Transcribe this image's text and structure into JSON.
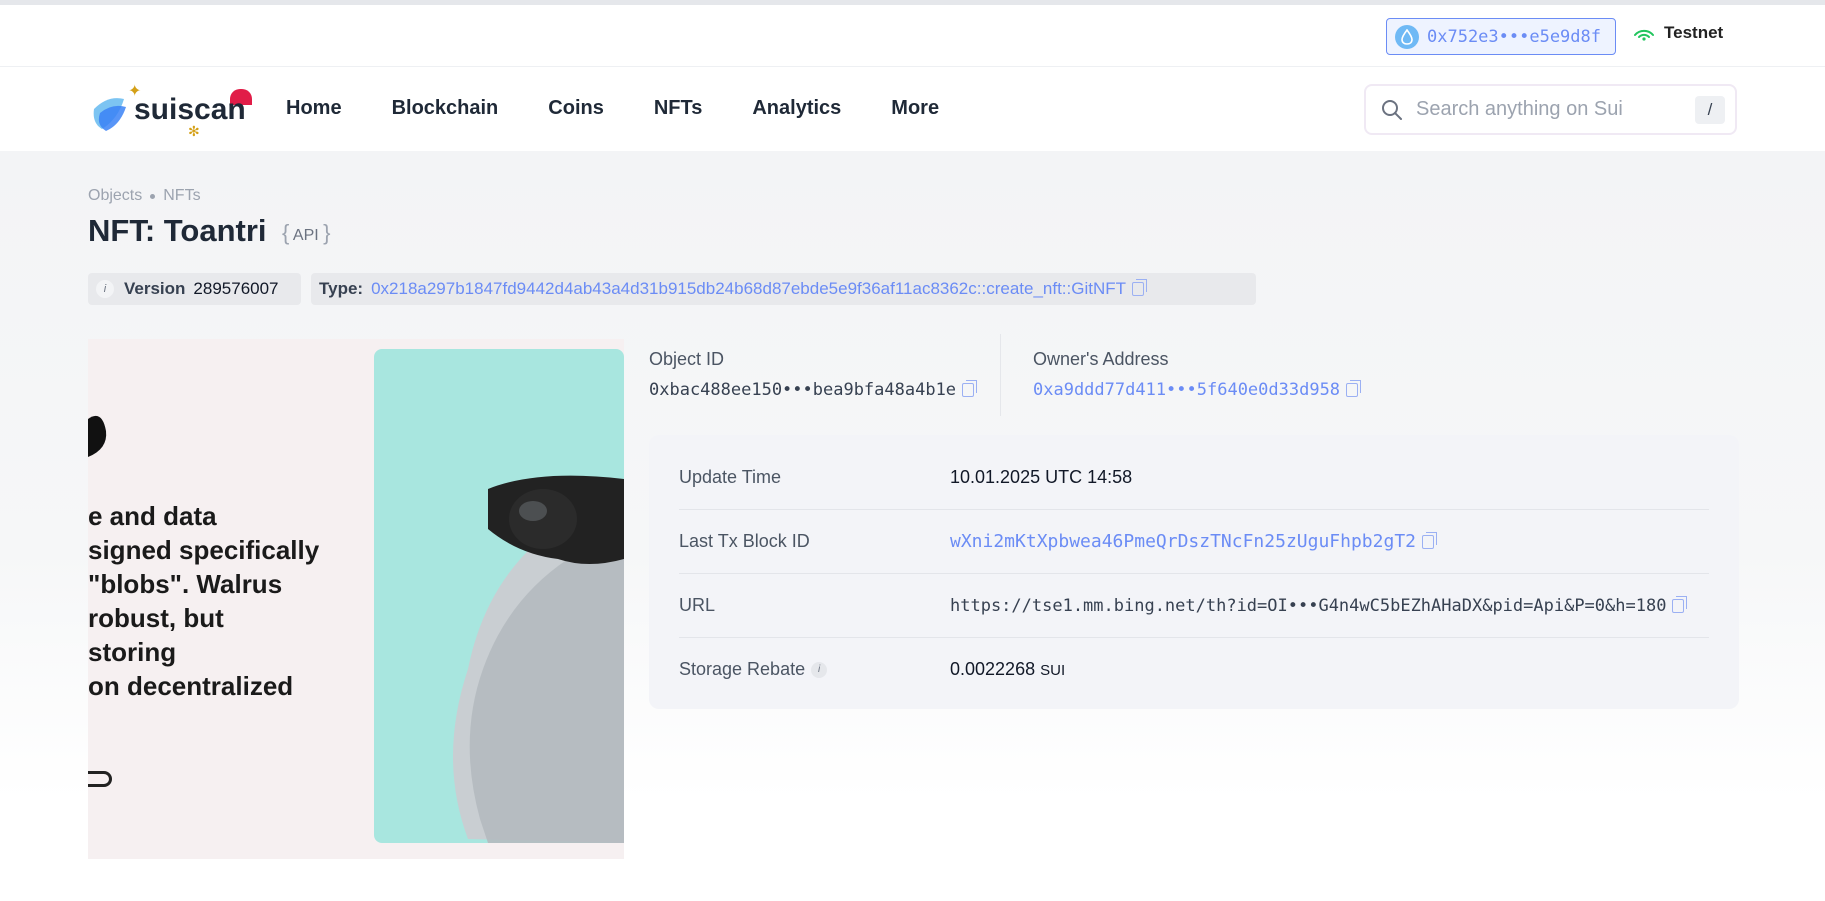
{
  "header": {
    "wallet_address": "0x752e3•••e5e9d8f",
    "network": "Testnet"
  },
  "navbar": {
    "logo_text": "suiscan",
    "items": [
      "Home",
      "Blockchain",
      "Coins",
      "NFTs",
      "Analytics",
      "More"
    ],
    "search_placeholder": "Search anything on Sui",
    "search_shortcut": "/"
  },
  "breadcrumb": [
    "Objects",
    "NFTs"
  ],
  "page": {
    "title": "NFT: Toantri",
    "api_label": "API"
  },
  "meta": {
    "version_label": "Version",
    "version_value": "289576007",
    "type_label": "Type:",
    "type_value": "0x218a297b1847fd9442d4ab43a4d31b915db24b68d87ebde5e9f36af11ac8362c::create_nft::GitNFT"
  },
  "nft_image": {
    "text_lines": [
      "e and data",
      "signed specifically",
      "\"blobs\". Walrus",
      "robust, but",
      "storing",
      "on decentralized"
    ]
  },
  "object": {
    "object_id_label": "Object ID",
    "object_id_value": "0xbac488ee150•••bea9bfa48a4b1e",
    "owner_label": "Owner's Address",
    "owner_value": "0xa9ddd77d411•••5f640e0d33d958"
  },
  "details": [
    {
      "label": "Update Time",
      "value": "10.01.2025 UTC 14:58"
    },
    {
      "label": "Last Tx Block ID",
      "value": "wXni2mKtXpbwea46PmeQrDszTNcFn25zUguFhpb2gT2"
    },
    {
      "label": "URL",
      "value": "https://tse1.mm.bing.net/th?id=OI•••G4n4wC5bEZhAHaDX&pid=Api&P=0&h=180"
    },
    {
      "label": "Storage Rebate",
      "value": "0.0022268",
      "unit": "SUI"
    }
  ],
  "colors": {
    "link": "#6b8cf5",
    "network_green": "#22c55e",
    "image_teal": "#a8e6df"
  }
}
